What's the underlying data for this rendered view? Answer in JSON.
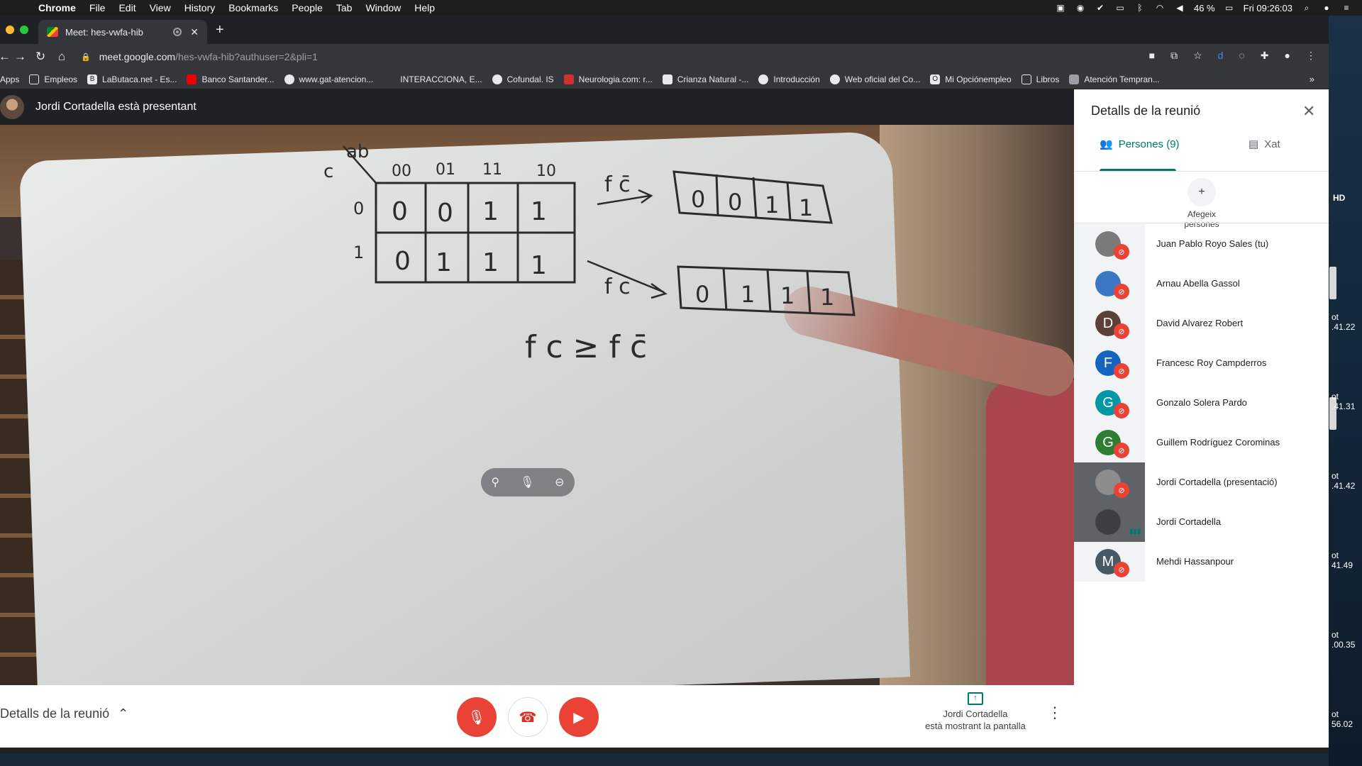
{
  "menubar": {
    "app": "Chrome",
    "items": [
      "File",
      "Edit",
      "View",
      "History",
      "Bookmarks",
      "People",
      "Tab",
      "Window",
      "Help"
    ],
    "battery": "46 %",
    "clock": "Fri 09:26:03"
  },
  "browser": {
    "tab_title": "Meet: hes-vwfa-hib",
    "url_host": "meet.google.com",
    "url_path": "/hes-vwfa-hib?authuser=2&pli=1",
    "bookmarks": [
      "Apps",
      "Empleos",
      "LaButaca.net - Es...",
      "Banco Santander...",
      "www.gat-atencion...",
      "INTERACCIONA, E...",
      "Cofundal. IS",
      "Neurologia.com: r...",
      "Crianza Natural -...",
      "Introducción",
      "Web oficial del Co...",
      "Mi Opciónempleo",
      "Libros",
      "Atención Tempran..."
    ]
  },
  "meet": {
    "presenter_text": "Jordi Cortadella està presentant",
    "hd_label": "HD",
    "details_label": "Detalls de la reunió",
    "presenting_line1": "Jordi Cortadella",
    "presenting_line2": "està mostrant la pantalla"
  },
  "whiteboard": {
    "corner_c": "c",
    "corner_ab": "ab",
    "headers": [
      "00",
      "01",
      "11",
      "10"
    ],
    "row_labels": [
      "0",
      "1"
    ],
    "grid": [
      [
        "0",
        "0",
        "1",
        "1"
      ],
      [
        "0",
        "1",
        "1",
        "1"
      ]
    ],
    "cofactor_top_label": "f c̄",
    "cofactor_top": [
      "0",
      "0",
      "1",
      "1"
    ],
    "cofactor_bottom_label": "f c",
    "cofactor_bottom": [
      "0",
      "1",
      "1",
      "1"
    ],
    "relation": "f c ≥ f c̄"
  },
  "panel": {
    "title": "Detalls de la reunió",
    "tab_people": "Persones (9)",
    "tab_chat": "Xat",
    "add_people_line1": "Afegeix",
    "add_people_line2": "persones",
    "people": [
      {
        "name": "Juan Pablo Royo Sales (tu)",
        "initial": "",
        "color": "#7a7a7a"
      },
      {
        "name": "Arnau Abella Gassol",
        "initial": "",
        "color": "#3b78c4"
      },
      {
        "name": "David Alvarez Robert",
        "initial": "D",
        "color": "#5d4037"
      },
      {
        "name": "Francesc Roy Campderros",
        "initial": "F",
        "color": "#1565c0"
      },
      {
        "name": "Gonzalo Solera Pardo",
        "initial": "G",
        "color": "#0097a7"
      },
      {
        "name": "Guillem Rodríguez Corominas",
        "initial": "G",
        "color": "#2e7d32"
      },
      {
        "name": "Jordi Cortadella (presentació)",
        "initial": "",
        "color": "#8d8d8d"
      },
      {
        "name": "Jordi Cortadella",
        "initial": "",
        "color": "#3c4043"
      },
      {
        "name": "Mehdi Hassanpour",
        "initial": "M",
        "color": "#455a64"
      }
    ]
  },
  "desktop_labels": [
    ".41.22",
    ".41.31",
    ".41.42",
    "41.49",
    ".00.35",
    "56.02"
  ],
  "desktop_prefix": "ot"
}
